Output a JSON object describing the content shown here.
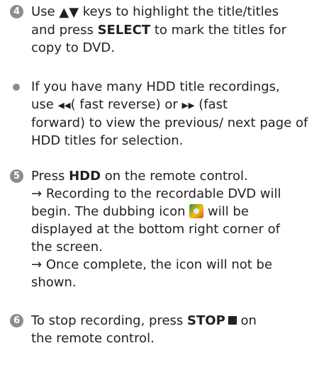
{
  "steps": [
    {
      "number": "4",
      "lines": [
        {
          "pre": "Use ",
          "glyph": "▲▼",
          "post": " keys to highlight the title/titles"
        },
        {
          "pre": "and press ",
          "bold": "SELECT",
          "post": " to mark the titles for"
        },
        {
          "text": "copy to DVD."
        }
      ]
    },
    {
      "bullet": true,
      "lines": [
        {
          "text": "If you have many HDD title recordings,"
        },
        {
          "pre": "use ",
          "glyph": "◂◂",
          "post": "( fast reverse) or ",
          "glyph2": "▸▸",
          "post2": " (fast"
        },
        {
          "text": "forward) to view the previous/ next page of"
        },
        {
          "text": "HDD titles for selection."
        }
      ]
    },
    {
      "number": "5",
      "lines": [
        {
          "pre": "Press ",
          "bold": "HDD",
          "post": " on the remote control."
        },
        {
          "pre": "→ ",
          "post": "Recording to the recordable DVD will"
        },
        {
          "pre": "begin. The dubbing icon ",
          "icon": "dubbing-icon",
          "post": " will be"
        },
        {
          "text": "displayed at the bottom right corner of"
        },
        {
          "text": "the screen."
        },
        {
          "pre": "→ ",
          "post": "Once complete, the icon will not be"
        },
        {
          "text": "shown."
        }
      ]
    },
    {
      "number": "6",
      "lines": [
        {
          "pre": "To stop recording, press ",
          "bold": "STOP",
          "post": " on"
        },
        {
          "text": "the remote control."
        }
      ]
    }
  ],
  "colors": {
    "marker": "#8c8c8c",
    "text": "#231f20"
  }
}
